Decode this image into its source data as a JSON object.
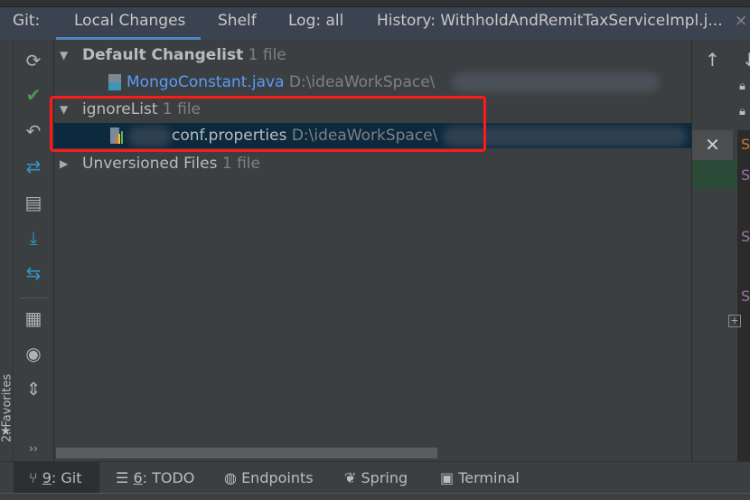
{
  "tabs": {
    "prefix": "Git:",
    "items": [
      {
        "label": "Local Changes",
        "selected": true
      },
      {
        "label": "Shelf"
      },
      {
        "label": "Log: all"
      },
      {
        "label": "History: WithholdAndRemitTaxServiceImpl.j..."
      }
    ]
  },
  "tree": {
    "default": {
      "name": "Default Changelist",
      "count": "1 file"
    },
    "mongo": {
      "name": "MongoConstant.java",
      "path": "D:\\ideaWorkSpace\\"
    },
    "ignore": {
      "name": "ignoreList",
      "count": "1 file"
    },
    "conf": {
      "name": "conf.properties",
      "path": "D:\\ideaWorkSpace\\"
    },
    "unversioned": {
      "name": "Unversioned Files",
      "count": "1 file"
    }
  },
  "favorites": "2: Favorites",
  "bottom": [
    {
      "num": "9",
      "label": ": Git"
    },
    {
      "num": "6",
      "label": ": TODO"
    },
    {
      "label": "Endpoints"
    },
    {
      "label": "Spring"
    },
    {
      "label": "Terminal"
    }
  ],
  "colors": {
    "accent": "#4a88c7",
    "selection": "#0d293e",
    "highlight": "#ff1a1a",
    "java_file": "#589df6"
  }
}
